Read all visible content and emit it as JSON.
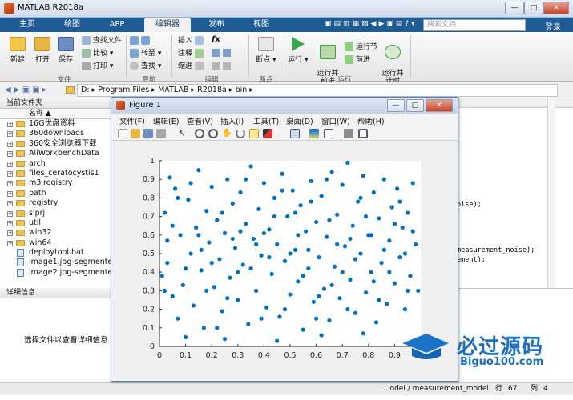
{
  "app": {
    "title": "MATLAB R2018a"
  },
  "tabs": [
    {
      "label": "主页"
    },
    {
      "label": "绘图"
    },
    {
      "label": "APP"
    },
    {
      "label": "编辑器"
    },
    {
      "label": "发布"
    },
    {
      "label": "视图"
    }
  ],
  "search": {
    "placeholder": "搜索文档"
  },
  "login_label": "登录",
  "ribbon": {
    "file": {
      "new": "新建",
      "open": "打开",
      "save": "保存",
      "find_files": "查找文件",
      "compare": "比较",
      "print": "打印",
      "section": "文件"
    },
    "nav": {
      "goto": "转至",
      "find": "查找",
      "section": "导航"
    },
    "edit": {
      "insert": "插入",
      "comment": "注释",
      "indent": "缩进",
      "fx": "fx",
      "section": "编辑"
    },
    "breakpoint": {
      "label": "断点",
      "section": "断点"
    },
    "run": {
      "run": "运行",
      "run_advance": "运行并\n前进",
      "run_section": "运行节",
      "advance": "前进",
      "run_time": "运行并\n计时",
      "section": "运行"
    }
  },
  "address": {
    "path": "D: ▸ Program Files ▸ MATLAB ▸ R2018a ▸ bin ▸"
  },
  "left_panel": {
    "title": "当前文件夹",
    "column": "名称 ▲",
    "items": [
      {
        "name": "16G优盘资料",
        "type": "folder"
      },
      {
        "name": "360downloads",
        "type": "folder"
      },
      {
        "name": "360安全浏览器下载",
        "type": "folder"
      },
      {
        "name": "AliWorkbenchData",
        "type": "folder"
      },
      {
        "name": "arch",
        "type": "folder"
      },
      {
        "name": "files_ceratocystis1",
        "type": "folder"
      },
      {
        "name": "m3iregistry",
        "type": "folder"
      },
      {
        "name": "path",
        "type": "folder"
      },
      {
        "name": "registry",
        "type": "folder"
      },
      {
        "name": "slprj",
        "type": "folder"
      },
      {
        "name": "util",
        "type": "folder"
      },
      {
        "name": "win32",
        "type": "folder"
      },
      {
        "name": "win64",
        "type": "folder"
      },
      {
        "name": "deploytool.bat",
        "type": "file"
      },
      {
        "name": "image1.jpg-segmente...",
        "type": "file"
      },
      {
        "name": "image2.jpg-segmente...",
        "type": "file"
      }
    ]
  },
  "details": {
    "title": "详细信息",
    "hint": "选择文件以查看详细信息"
  },
  "editor": {
    "lines": [
      "oise);",
      "measurement_noise);",
      "ement);"
    ]
  },
  "status": {
    "file": "...odel / measurement_model",
    "row_label": "行",
    "row": "67",
    "col_label": "列",
    "col": "4"
  },
  "figure": {
    "title": "Figure 1",
    "menu": [
      "文件(F)",
      "编辑(E)",
      "查看(V)",
      "插入(I)",
      "工具(T)",
      "桌面(D)",
      "窗口(W)",
      "帮助(H)"
    ]
  },
  "watermark": {
    "text": "必过源码",
    "url": "Biguo100.com"
  },
  "chart_data": {
    "type": "scatter",
    "title": "",
    "xlabel": "",
    "ylabel": "",
    "xlim": [
      0,
      1
    ],
    "ylim": [
      0,
      1
    ],
    "xticks": [
      0,
      0.1,
      0.2,
      0.3,
      0.4,
      0.5,
      0.6,
      0.7,
      0.8,
      0.9
    ],
    "yticks": [
      0,
      0.1,
      0.2,
      0.3,
      0.4,
      0.5,
      0.6,
      0.7,
      0.8,
      0.9,
      1
    ],
    "marker_color": "#0072bd",
    "marker": "filled circle",
    "points": [
      [
        0.02,
        0.72
      ],
      [
        0.03,
        0.45
      ],
      [
        0.01,
        0.38
      ],
      [
        0.04,
        0.91
      ],
      [
        0.06,
        0.85
      ],
      [
        0.08,
        0.6
      ],
      [
        0.05,
        0.27
      ],
      [
        0.07,
        0.15
      ],
      [
        0.09,
        0.33
      ],
      [
        0.03,
        0.57
      ],
      [
        0.11,
        0.79
      ],
      [
        0.12,
        0.5
      ],
      [
        0.13,
        0.22
      ],
      [
        0.15,
        0.95
      ],
      [
        0.14,
        0.64
      ],
      [
        0.16,
        0.41
      ],
      [
        0.18,
        0.73
      ],
      [
        0.17,
        0.1
      ],
      [
        0.19,
        0.56
      ],
      [
        0.2,
        0.86
      ],
      [
        0.21,
        0.32
      ],
      [
        0.22,
        0.68
      ],
      [
        0.23,
        0.47
      ],
      [
        0.24,
        0.19
      ],
      [
        0.26,
        0.9
      ],
      [
        0.25,
        0.61
      ],
      [
        0.27,
        0.37
      ],
      [
        0.28,
        0.77
      ],
      [
        0.29,
        0.53
      ],
      [
        0.3,
        0.25
      ],
      [
        0.31,
        0.83
      ],
      [
        0.32,
        0.44
      ],
      [
        0.33,
        0.66
      ],
      [
        0.34,
        0.12
      ],
      [
        0.35,
        0.97
      ],
      [
        0.36,
        0.58
      ],
      [
        0.37,
        0.3
      ],
      [
        0.38,
        0.74
      ],
      [
        0.39,
        0.49
      ],
      [
        0.4,
        0.88
      ],
      [
        0.41,
        0.21
      ],
      [
        0.42,
        0.63
      ],
      [
        0.43,
        0.39
      ],
      [
        0.44,
        0.8
      ],
      [
        0.45,
        0.55
      ],
      [
        0.46,
        0.16
      ],
      [
        0.47,
        0.93
      ],
      [
        0.48,
        0.46
      ],
      [
        0.49,
        0.7
      ],
      [
        0.5,
        0.28
      ],
      [
        0.51,
        0.84
      ],
      [
        0.52,
        0.52
      ],
      [
        0.53,
        0.35
      ],
      [
        0.54,
        0.76
      ],
      [
        0.55,
        0.09
      ],
      [
        0.56,
        0.62
      ],
      [
        0.57,
        0.42
      ],
      [
        0.58,
        0.89
      ],
      [
        0.59,
        0.24
      ],
      [
        0.6,
        0.67
      ],
      [
        0.61,
        0.48
      ],
      [
        0.62,
        0.81
      ],
      [
        0.63,
        0.31
      ],
      [
        0.64,
        0.59
      ],
      [
        0.65,
        0.14
      ],
      [
        0.66,
        0.94
      ],
      [
        0.67,
        0.43
      ],
      [
        0.68,
        0.71
      ],
      [
        0.69,
        0.26
      ],
      [
        0.7,
        0.87
      ],
      [
        0.71,
        0.54
      ],
      [
        0.72,
        0.99
      ],
      [
        0.73,
        0.36
      ],
      [
        0.74,
        0.65
      ],
      [
        0.75,
        0.18
      ],
      [
        0.76,
        0.78
      ],
      [
        0.77,
        0.5
      ],
      [
        0.78,
        0.92
      ],
      [
        0.79,
        0.29
      ],
      [
        0.8,
        0.6
      ],
      [
        0.81,
        0.4
      ],
      [
        0.82,
        0.83
      ],
      [
        0.83,
        0.13
      ],
      [
        0.84,
        0.69
      ],
      [
        0.85,
        0.45
      ],
      [
        0.86,
        0.9
      ],
      [
        0.87,
        0.23
      ],
      [
        0.88,
        0.57
      ],
      [
        0.89,
        0.75
      ],
      [
        0.9,
        0.34
      ],
      [
        0.91,
        0.85
      ],
      [
        0.92,
        0.48
      ],
      [
        0.93,
        0.64
      ],
      [
        0.94,
        0.2
      ],
      [
        0.95,
        0.72
      ],
      [
        0.96,
        0.38
      ],
      [
        0.97,
        0.88
      ],
      [
        0.98,
        0.55
      ],
      [
        0.99,
        0.3
      ],
      [
        0.1,
        0.05
      ],
      [
        0.25,
        0.04
      ],
      [
        0.45,
        0.03
      ],
      [
        0.62,
        0.06
      ],
      [
        0.78,
        0.07
      ],
      [
        0.35,
        0.42
      ],
      [
        0.5,
        0.5
      ],
      [
        0.15,
        0.6
      ],
      [
        0.86,
        0.52
      ],
      [
        0.66,
        0.33
      ],
      [
        0.05,
        0.65
      ],
      [
        0.2,
        0.45
      ],
      [
        0.4,
        0.61
      ],
      [
        0.58,
        0.78
      ],
      [
        0.73,
        0.58
      ],
      [
        0.9,
        0.66
      ],
      [
        0.12,
        0.88
      ],
      [
        0.28,
        0.58
      ],
      [
        0.48,
        0.2
      ],
      [
        0.64,
        0.9
      ],
      [
        0.82,
        0.35
      ],
      [
        0.33,
        0.9
      ],
      [
        0.53,
        0.6
      ],
      [
        0.7,
        0.4
      ],
      [
        0.18,
        0.3
      ],
      [
        0.44,
        0.7
      ],
      [
        0.6,
        0.15
      ],
      [
        0.77,
        0.8
      ],
      [
        0.94,
        0.5
      ],
      [
        0.07,
        0.8
      ],
      [
        0.24,
        0.72
      ],
      [
        0.39,
        0.15
      ],
      [
        0.57,
        0.52
      ],
      [
        0.75,
        0.47
      ],
      [
        0.92,
        0.78
      ],
      [
        0.1,
        0.42
      ],
      [
        0.31,
        0.62
      ],
      [
        0.47,
        0.84
      ],
      [
        0.65,
        0.68
      ],
      [
        0.81,
        0.6
      ],
      [
        0.97,
        0.62
      ],
      [
        0.02,
        0.3
      ],
      [
        0.22,
        0.1
      ],
      [
        0.37,
        0.55
      ],
      [
        0.55,
        0.38
      ],
      [
        0.72,
        0.2
      ],
      [
        0.88,
        0.4
      ],
      [
        0.16,
        0.52
      ],
      [
        0.3,
        0.4
      ],
      [
        0.52,
        0.72
      ],
      [
        0.68,
        0.55
      ],
      [
        0.84,
        0.25
      ],
      [
        0.42,
        0.48
      ],
      [
        0.26,
        0.26
      ],
      [
        0.61,
        0.27
      ],
      [
        0.79,
        0.7
      ],
      [
        0.95,
        0.3
      ]
    ]
  }
}
